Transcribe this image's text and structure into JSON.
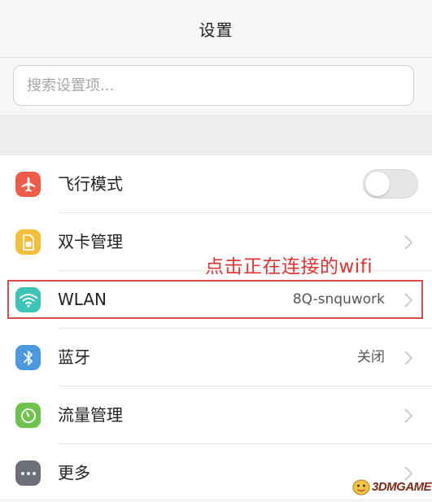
{
  "header": {
    "title": "设置"
  },
  "search": {
    "placeholder": "搜索设置项..."
  },
  "settings": {
    "items": [
      {
        "label": "飞行模式",
        "icon": "airplane-icon",
        "icon_color": "#ee5c47",
        "control": "toggle",
        "toggle_on": false
      },
      {
        "label": "双卡管理",
        "icon": "sim-card-icon",
        "icon_color": "#f4be3b",
        "control": "chevron"
      },
      {
        "label": "WLAN",
        "icon": "wifi-icon",
        "icon_color": "#3cc4b4",
        "value": "8Q-snquwork",
        "control": "chevron"
      },
      {
        "label": "蓝牙",
        "icon": "bluetooth-icon",
        "icon_color": "#4a98e0",
        "value": "关闭",
        "control": "chevron"
      },
      {
        "label": "流量管理",
        "icon": "data-usage-icon",
        "icon_color": "#6fc24e",
        "control": "chevron"
      },
      {
        "label": "更多",
        "icon": "more-icon",
        "icon_color": "#6c6f78",
        "control": "chevron"
      }
    ]
  },
  "annotation": {
    "text": "点击正在连接的wifi",
    "color": "#e03434"
  },
  "watermark": {
    "text": "3DMGAME"
  }
}
